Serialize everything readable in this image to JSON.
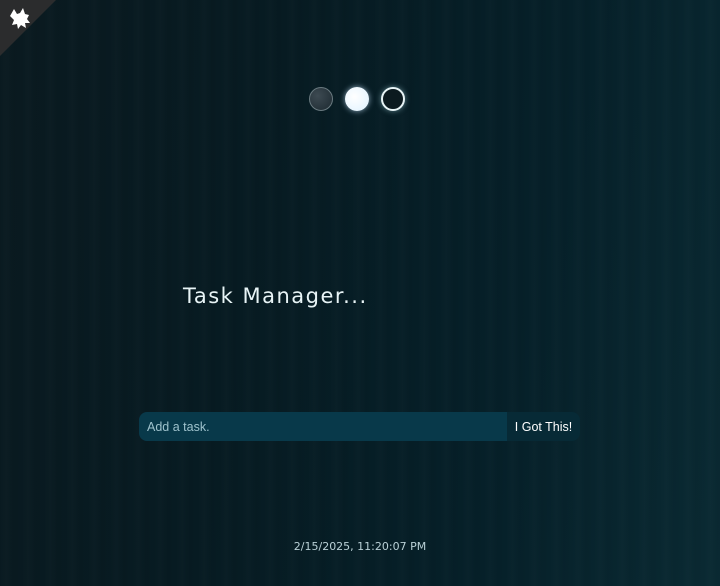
{
  "logo": {
    "icon": "fox-logo-icon"
  },
  "themes": [
    {
      "name": "standard",
      "color": "#2c3940"
    },
    {
      "name": "light",
      "color": "#eef8ff"
    },
    {
      "name": "darker",
      "color": "#0c1a1f"
    }
  ],
  "header": {
    "title": "Task Manager..."
  },
  "task_form": {
    "input_placeholder": "Add a task.",
    "input_value": "",
    "submit_label": "I Got This!"
  },
  "footer": {
    "datetime": "2/15/2025, 11:20:07 PM"
  },
  "colors": {
    "background": "#071b22",
    "input_bg": "#08394a",
    "button_bg": "#072a36",
    "text": "#e8f4f6"
  }
}
